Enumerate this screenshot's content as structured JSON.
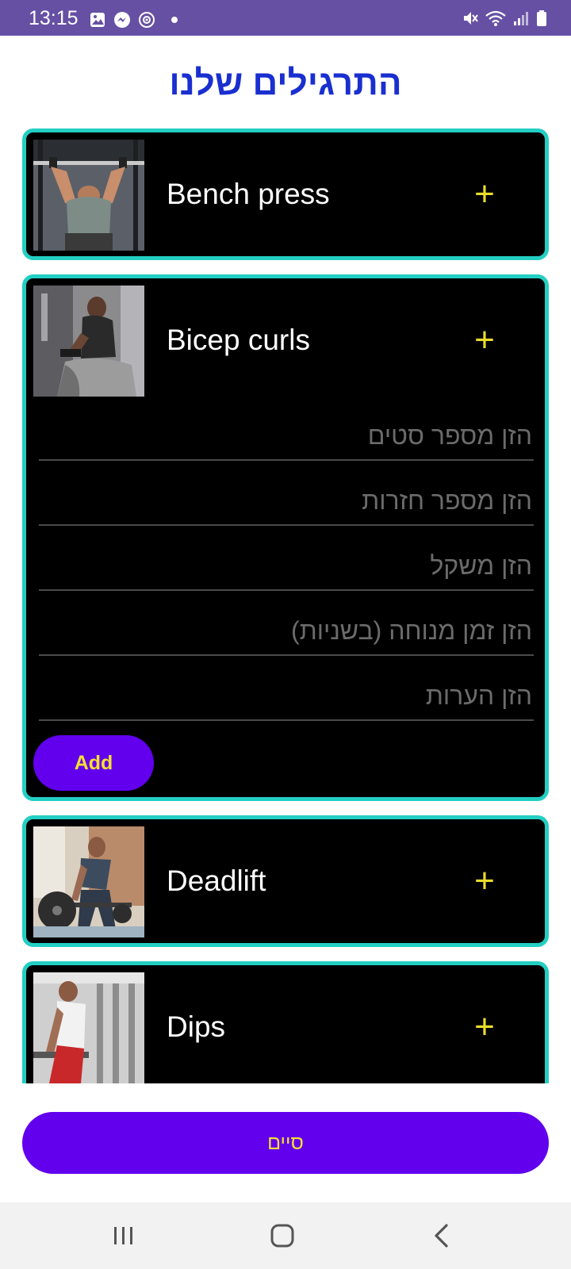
{
  "status_bar": {
    "time": "13:15",
    "left_icons": [
      "gallery-icon",
      "messenger-icon",
      "sync-icon",
      "dot-icon"
    ],
    "right_icons": [
      "mute-icon",
      "wifi-icon",
      "signal-icon",
      "battery-icon"
    ],
    "background": "#6650a4"
  },
  "header": {
    "title": "התרגילים שלנו"
  },
  "exercises": [
    {
      "name": "Bench press",
      "plus": "+"
    },
    {
      "name": "Bicep curls",
      "plus": "+",
      "form": {
        "sets_placeholder": "הזן מספר סטים",
        "reps_placeholder": "הזן מספר חזרות",
        "weight_placeholder": "הזן משקל",
        "rest_placeholder": "הזן זמן מנוחה (בשניות)",
        "notes_placeholder": "הזן הערות",
        "add_label": "Add"
      }
    },
    {
      "name": "Deadlift",
      "plus": "+"
    },
    {
      "name": "Dips",
      "plus": "+"
    }
  ],
  "footer": {
    "finish_label": "סיים"
  },
  "nav_bar": {
    "icons": [
      "recents-icon",
      "home-icon",
      "back-icon"
    ]
  },
  "colors": {
    "accent": "#6200ee",
    "title": "#1a2fcf",
    "card_border": "#23cfc3",
    "plus": "#e8dd2a",
    "button_text": "#f5e030"
  }
}
